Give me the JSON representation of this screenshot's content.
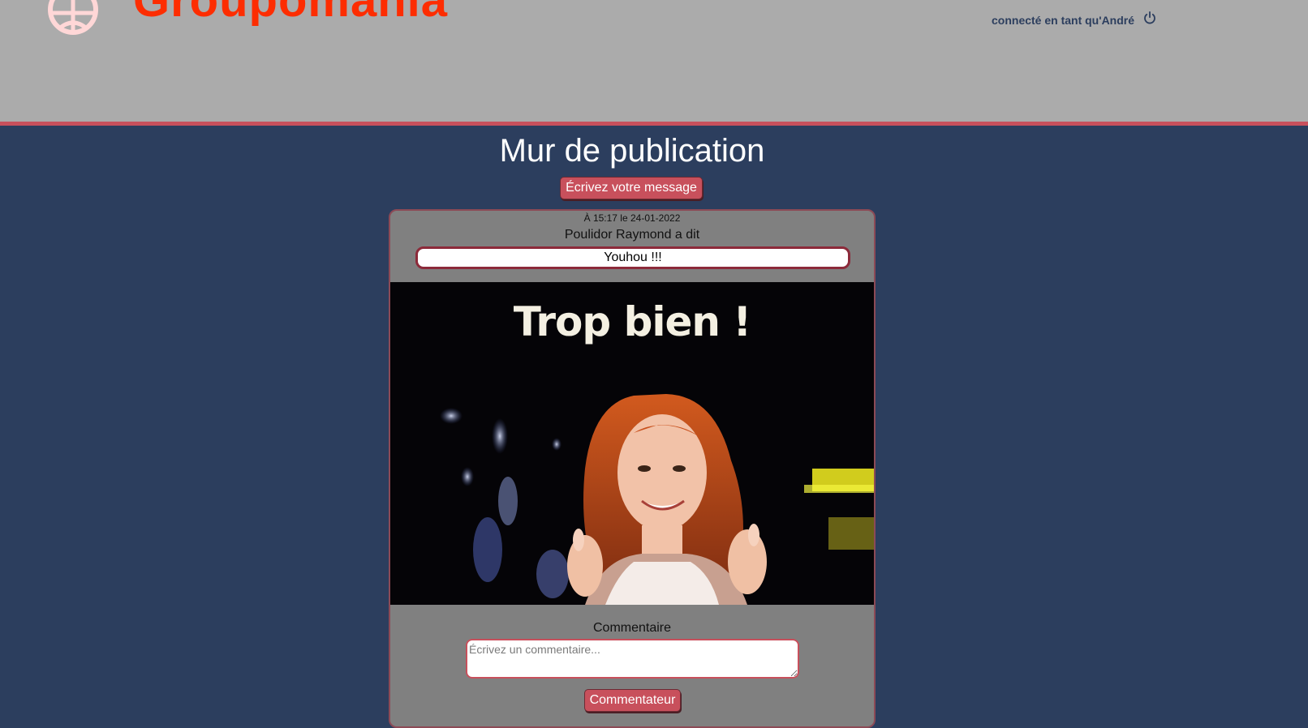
{
  "header": {
    "brand": "Groupomania",
    "user_label": "connecté en tant qu'André",
    "logo_icon": "globe-icon",
    "logout_icon": "power-icon"
  },
  "main": {
    "page_title": "Mur de publication",
    "write_button": "Écrivez votre message"
  },
  "post": {
    "date": "À 15:17 le 24-01-2022",
    "author": "Poulidor Raymond a dit",
    "message": "Youhou !!!",
    "image_caption": "Trop bien !",
    "comment_label": "Commentaire",
    "comment_placeholder": "Écrivez un commentaire...",
    "comment_button": "Commentateur"
  },
  "colors": {
    "header_bg": "#ababab",
    "accent": "#c8505c",
    "page_bg": "#2c3e5e",
    "brand": "#fd2d01",
    "card_bg": "#808080"
  }
}
